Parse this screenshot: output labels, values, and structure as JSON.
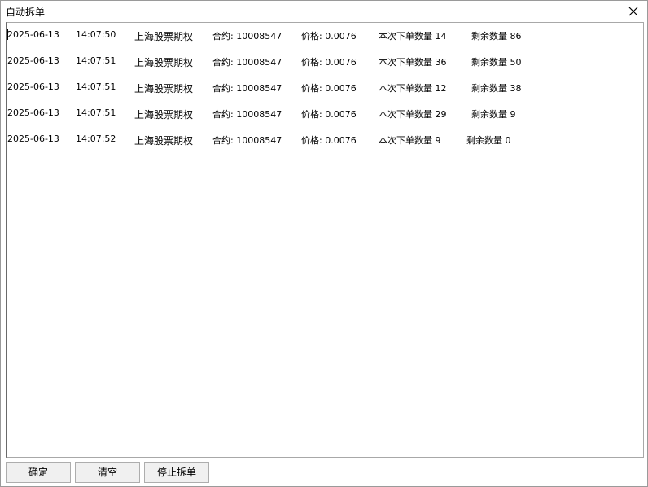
{
  "window": {
    "title": "自动拆单"
  },
  "log": {
    "rows": [
      {
        "date": "2025-06-13",
        "time": "14:07:50",
        "exchange": "上海股票期权",
        "contract": "合约: 10008547",
        "price": "价格: 0.0076",
        "order_qty": "本次下单数量 14",
        "remaining": "剩余数量 86"
      },
      {
        "date": "2025-06-13",
        "time": "14:07:51",
        "exchange": "上海股票期权",
        "contract": "合约: 10008547",
        "price": "价格: 0.0076",
        "order_qty": "本次下单数量 36",
        "remaining": "剩余数量 50"
      },
      {
        "date": "2025-06-13",
        "time": "14:07:51",
        "exchange": "上海股票期权",
        "contract": "合约: 10008547",
        "price": "价格: 0.0076",
        "order_qty": "本次下单数量 12",
        "remaining": "剩余数量 38"
      },
      {
        "date": "2025-06-13",
        "time": "14:07:51",
        "exchange": "上海股票期权",
        "contract": "合约: 10008547",
        "price": "价格: 0.0076",
        "order_qty": "本次下单数量 29",
        "remaining": "剩余数量 9"
      },
      {
        "date": "2025-06-13",
        "time": "14:07:52",
        "exchange": "上海股票期权",
        "contract": "合约: 10008547",
        "price": "价格: 0.0076",
        "order_qty": "本次下单数量 9",
        "remaining": "剩余数量 0"
      }
    ]
  },
  "buttons": {
    "ok_label": "确定",
    "clear_label": "清空",
    "stop_label": "停止拆单"
  }
}
